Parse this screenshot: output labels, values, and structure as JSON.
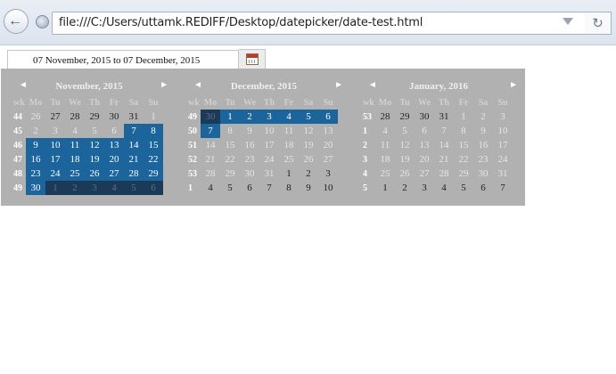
{
  "browser": {
    "url": "file:///C:/Users/uttamk.REDIFF/Desktop/datepicker/date-test.html"
  },
  "datepicker": {
    "input_value": "07 November, 2015 to 07 December, 2015",
    "prev_symbol": "◄",
    "next_symbol": "►",
    "colors": {
      "panel": "#b1b1b1",
      "selected": "#1b649c",
      "selected_dark": "#1b3a58"
    },
    "months": [
      {
        "title": "November, 2015",
        "header": [
          "wk",
          "Mo",
          "Tu",
          "We",
          "Th",
          "Fr",
          "Sa",
          "Su"
        ],
        "weeks": [
          {
            "wk": "44",
            "days": [
              {
                "d": "26",
                "t": "out"
              },
              {
                "d": "27",
                "t": "in"
              },
              {
                "d": "28",
                "t": "in"
              },
              {
                "d": "29",
                "t": "in"
              },
              {
                "d": "30",
                "t": "in"
              },
              {
                "d": "31",
                "t": "in"
              },
              {
                "d": "1",
                "t": "out"
              }
            ]
          },
          {
            "wk": "45",
            "days": [
              {
                "d": "2",
                "t": "out"
              },
              {
                "d": "3",
                "t": "out"
              },
              {
                "d": "4",
                "t": "out"
              },
              {
                "d": "5",
                "t": "out"
              },
              {
                "d": "6",
                "t": "out"
              },
              {
                "d": "7",
                "t": "sel"
              },
              {
                "d": "8",
                "t": "sel"
              }
            ]
          },
          {
            "wk": "46",
            "days": [
              {
                "d": "9",
                "t": "sel"
              },
              {
                "d": "10",
                "t": "sel"
              },
              {
                "d": "11",
                "t": "sel"
              },
              {
                "d": "12",
                "t": "sel"
              },
              {
                "d": "13",
                "t": "sel"
              },
              {
                "d": "14",
                "t": "sel"
              },
              {
                "d": "15",
                "t": "sel"
              }
            ]
          },
          {
            "wk": "47",
            "days": [
              {
                "d": "16",
                "t": "sel"
              },
              {
                "d": "17",
                "t": "sel"
              },
              {
                "d": "18",
                "t": "sel"
              },
              {
                "d": "19",
                "t": "sel"
              },
              {
                "d": "20",
                "t": "sel"
              },
              {
                "d": "21",
                "t": "sel"
              },
              {
                "d": "22",
                "t": "sel"
              }
            ]
          },
          {
            "wk": "48",
            "days": [
              {
                "d": "23",
                "t": "sel"
              },
              {
                "d": "24",
                "t": "sel"
              },
              {
                "d": "25",
                "t": "sel"
              },
              {
                "d": "26",
                "t": "sel"
              },
              {
                "d": "27",
                "t": "sel"
              },
              {
                "d": "28",
                "t": "sel"
              },
              {
                "d": "29",
                "t": "sel"
              }
            ]
          },
          {
            "wk": "49",
            "days": [
              {
                "d": "30",
                "t": "sel"
              },
              {
                "d": "1",
                "t": "selout"
              },
              {
                "d": "2",
                "t": "selout"
              },
              {
                "d": "3",
                "t": "selout"
              },
              {
                "d": "4",
                "t": "selout"
              },
              {
                "d": "5",
                "t": "selout"
              },
              {
                "d": "6",
                "t": "selout"
              }
            ]
          }
        ]
      },
      {
        "title": "December, 2015",
        "header": [
          "wk",
          "Mo",
          "Tu",
          "We",
          "Th",
          "Fr",
          "Sa",
          "Su"
        ],
        "weeks": [
          {
            "wk": "49",
            "days": [
              {
                "d": "30",
                "t": "start"
              },
              {
                "d": "1",
                "t": "sel"
              },
              {
                "d": "2",
                "t": "sel"
              },
              {
                "d": "3",
                "t": "sel"
              },
              {
                "d": "4",
                "t": "sel"
              },
              {
                "d": "5",
                "t": "sel"
              },
              {
                "d": "6",
                "t": "sel"
              }
            ]
          },
          {
            "wk": "50",
            "days": [
              {
                "d": "7",
                "t": "sel"
              },
              {
                "d": "8",
                "t": "out"
              },
              {
                "d": "9",
                "t": "out"
              },
              {
                "d": "10",
                "t": "out"
              },
              {
                "d": "11",
                "t": "out"
              },
              {
                "d": "12",
                "t": "out"
              },
              {
                "d": "13",
                "t": "out"
              }
            ]
          },
          {
            "wk": "51",
            "days": [
              {
                "d": "14",
                "t": "out"
              },
              {
                "d": "15",
                "t": "out"
              },
              {
                "d": "16",
                "t": "out"
              },
              {
                "d": "17",
                "t": "out"
              },
              {
                "d": "18",
                "t": "out"
              },
              {
                "d": "19",
                "t": "out"
              },
              {
                "d": "20",
                "t": "out"
              }
            ]
          },
          {
            "wk": "52",
            "days": [
              {
                "d": "21",
                "t": "out"
              },
              {
                "d": "22",
                "t": "out"
              },
              {
                "d": "23",
                "t": "out"
              },
              {
                "d": "24",
                "t": "out"
              },
              {
                "d": "25",
                "t": "out"
              },
              {
                "d": "26",
                "t": "out"
              },
              {
                "d": "27",
                "t": "out"
              }
            ]
          },
          {
            "wk": "53",
            "days": [
              {
                "d": "28",
                "t": "out"
              },
              {
                "d": "29",
                "t": "out"
              },
              {
                "d": "30",
                "t": "out"
              },
              {
                "d": "31",
                "t": "out"
              },
              {
                "d": "1",
                "t": "in"
              },
              {
                "d": "2",
                "t": "in"
              },
              {
                "d": "3",
                "t": "in"
              }
            ]
          },
          {
            "wk": "1",
            "days": [
              {
                "d": "4",
                "t": "in"
              },
              {
                "d": "5",
                "t": "in"
              },
              {
                "d": "6",
                "t": "in"
              },
              {
                "d": "7",
                "t": "in"
              },
              {
                "d": "8",
                "t": "in"
              },
              {
                "d": "9",
                "t": "in"
              },
              {
                "d": "10",
                "t": "in"
              }
            ]
          }
        ]
      },
      {
        "title": "January, 2016",
        "header": [
          "wk",
          "Mo",
          "Tu",
          "We",
          "Th",
          "Fr",
          "Sa",
          "Su"
        ],
        "weeks": [
          {
            "wk": "53",
            "days": [
              {
                "d": "28",
                "t": "in"
              },
              {
                "d": "29",
                "t": "in"
              },
              {
                "d": "30",
                "t": "in"
              },
              {
                "d": "31",
                "t": "in"
              },
              {
                "d": "1",
                "t": "out"
              },
              {
                "d": "2",
                "t": "out"
              },
              {
                "d": "3",
                "t": "out"
              }
            ]
          },
          {
            "wk": "1",
            "days": [
              {
                "d": "4",
                "t": "out"
              },
              {
                "d": "5",
                "t": "out"
              },
              {
                "d": "6",
                "t": "out"
              },
              {
                "d": "7",
                "t": "out"
              },
              {
                "d": "8",
                "t": "out"
              },
              {
                "d": "9",
                "t": "out"
              },
              {
                "d": "10",
                "t": "out"
              }
            ]
          },
          {
            "wk": "2",
            "days": [
              {
                "d": "11",
                "t": "out"
              },
              {
                "d": "12",
                "t": "out"
              },
              {
                "d": "13",
                "t": "out"
              },
              {
                "d": "14",
                "t": "out"
              },
              {
                "d": "15",
                "t": "out"
              },
              {
                "d": "16",
                "t": "out"
              },
              {
                "d": "17",
                "t": "out"
              }
            ]
          },
          {
            "wk": "3",
            "days": [
              {
                "d": "18",
                "t": "out"
              },
              {
                "d": "19",
                "t": "out"
              },
              {
                "d": "20",
                "t": "out"
              },
              {
                "d": "21",
                "t": "out"
              },
              {
                "d": "22",
                "t": "out"
              },
              {
                "d": "23",
                "t": "out"
              },
              {
                "d": "24",
                "t": "out"
              }
            ]
          },
          {
            "wk": "4",
            "days": [
              {
                "d": "25",
                "t": "out"
              },
              {
                "d": "26",
                "t": "out"
              },
              {
                "d": "27",
                "t": "out"
              },
              {
                "d": "28",
                "t": "out"
              },
              {
                "d": "29",
                "t": "out"
              },
              {
                "d": "30",
                "t": "out"
              },
              {
                "d": "31",
                "t": "out"
              }
            ]
          },
          {
            "wk": "5",
            "days": [
              {
                "d": "1",
                "t": "in"
              },
              {
                "d": "2",
                "t": "in"
              },
              {
                "d": "3",
                "t": "in"
              },
              {
                "d": "4",
                "t": "in"
              },
              {
                "d": "5",
                "t": "in"
              },
              {
                "d": "6",
                "t": "in"
              },
              {
                "d": "7",
                "t": "in"
              }
            ]
          }
        ]
      }
    ]
  }
}
